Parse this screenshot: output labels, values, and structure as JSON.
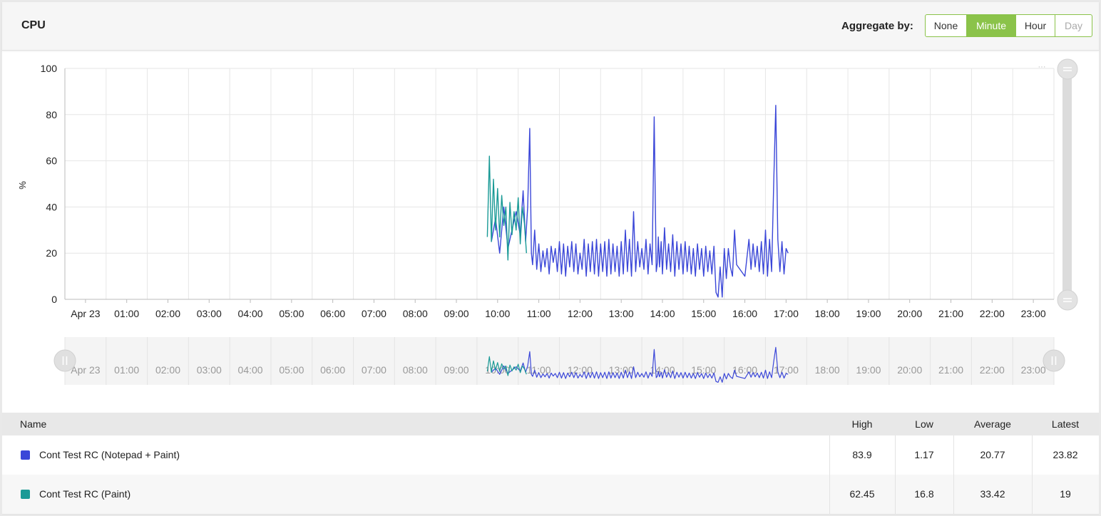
{
  "header": {
    "title": "CPU",
    "aggregate_label": "Aggregate by:",
    "options": [
      "None",
      "Minute",
      "Hour",
      "Day"
    ],
    "selected": "Minute",
    "disabled": [
      "Day"
    ]
  },
  "colors": {
    "accent": "#8bc34a",
    "series_blue": "#3b47d8",
    "series_teal": "#1a9a96"
  },
  "chart_data": {
    "type": "line",
    "ylabel": "%",
    "ylim": [
      0,
      100
    ],
    "yticks": [
      0,
      20,
      40,
      60,
      80,
      100
    ],
    "xlim": [
      -0.5,
      23.5
    ],
    "xticks": [
      "Apr 23",
      "01:00",
      "02:00",
      "03:00",
      "04:00",
      "05:00",
      "06:00",
      "07:00",
      "08:00",
      "09:00",
      "10:00",
      "11:00",
      "12:00",
      "13:00",
      "14:00",
      "15:00",
      "16:00",
      "17:00",
      "18:00",
      "19:00",
      "20:00",
      "21:00",
      "22:00",
      "23:00"
    ],
    "grid": true,
    "series": [
      {
        "name": "Cont Test RC (Notepad + Paint)",
        "color": "#3b47d8",
        "x": [
          9.85,
          9.95,
          10.05,
          10.15,
          10.25,
          10.35,
          10.45,
          10.55,
          10.62,
          10.68,
          10.73,
          10.78,
          10.82,
          10.85,
          10.9,
          10.95,
          11.0,
          11.05,
          11.1,
          11.15,
          11.2,
          11.25,
          11.3,
          11.35,
          11.4,
          11.45,
          11.5,
          11.55,
          11.6,
          11.65,
          11.7,
          11.75,
          11.8,
          11.85,
          11.9,
          11.95,
          12.0,
          12.05,
          12.1,
          12.15,
          12.2,
          12.25,
          12.3,
          12.35,
          12.4,
          12.45,
          12.5,
          12.55,
          12.6,
          12.65,
          12.7,
          12.75,
          12.8,
          12.85,
          12.9,
          12.95,
          13.0,
          13.05,
          13.1,
          13.15,
          13.2,
          13.25,
          13.3,
          13.35,
          13.4,
          13.45,
          13.5,
          13.55,
          13.6,
          13.65,
          13.7,
          13.75,
          13.8,
          13.85,
          13.88,
          13.9,
          13.93,
          13.97,
          14.0,
          14.05,
          14.1,
          14.15,
          14.2,
          14.25,
          14.3,
          14.35,
          14.4,
          14.45,
          14.5,
          14.55,
          14.6,
          14.65,
          14.7,
          14.75,
          14.8,
          14.85,
          14.9,
          14.95,
          15.0,
          15.05,
          15.1,
          15.15,
          15.2,
          15.25,
          15.3,
          15.35,
          15.4,
          15.45,
          15.5,
          15.55,
          15.6,
          15.65,
          15.7,
          15.75,
          15.8,
          16.0,
          16.1,
          16.15,
          16.2,
          16.25,
          16.3,
          16.35,
          16.4,
          16.45,
          16.5,
          16.55,
          16.6,
          16.65,
          16.7,
          16.75,
          16.8,
          16.85,
          16.9,
          16.95,
          17.0,
          17.05
        ],
        "y": [
          25,
          35,
          20,
          40,
          22,
          30,
          38,
          28,
          47,
          25,
          40,
          74,
          20,
          15,
          30,
          13,
          24,
          12,
          21,
          14,
          22,
          11,
          23,
          16,
          22,
          12,
          25,
          11,
          24,
          10,
          23,
          14,
          25,
          12,
          24,
          11,
          20,
          13,
          26,
          10,
          24,
          12,
          25,
          11,
          26,
          10,
          24,
          12,
          25,
          10,
          26,
          11,
          24,
          12,
          23,
          10,
          25,
          11,
          30,
          12,
          26,
          10,
          38,
          12,
          25,
          14,
          22,
          13,
          26,
          11,
          24,
          15,
          79,
          12,
          16,
          27,
          14,
          25,
          11,
          31,
          13,
          24,
          12,
          28,
          10,
          25,
          13,
          24,
          11,
          25,
          12,
          23,
          11,
          22,
          10,
          24,
          13,
          22,
          10,
          23,
          12,
          21,
          11,
          23,
          3,
          1,
          14,
          1,
          22,
          9,
          22,
          14,
          10,
          30,
          15,
          10,
          26,
          13,
          24,
          14,
          23,
          12,
          25,
          11,
          30,
          10,
          26,
          12,
          50,
          84,
          26,
          12,
          25,
          11,
          22,
          20
        ],
        "latest": "23.82",
        "high": "83.9",
        "low": "1.17",
        "average": "20.77"
      },
      {
        "name": "Cont Test RC (Paint)",
        "color": "#1a9a96",
        "x": [
          9.75,
          9.8,
          9.85,
          9.9,
          9.95,
          10.0,
          10.05,
          10.1,
          10.15,
          10.2,
          10.25,
          10.3,
          10.35,
          10.4,
          10.45,
          10.5,
          10.55,
          10.6,
          10.65,
          10.7
        ],
        "y": [
          27,
          62,
          25,
          52,
          30,
          48,
          27,
          45,
          32,
          40,
          17,
          42,
          28,
          38,
          30,
          44,
          24,
          40,
          33,
          20
        ],
        "high": "62.45",
        "low": "16.8",
        "average": "33.42",
        "latest": "19"
      }
    ]
  },
  "table": {
    "columns": [
      "Name",
      "High",
      "Low",
      "Average",
      "Latest"
    ],
    "rows": [
      {
        "name": "Cont Test RC (Notepad + Paint)",
        "color": "#3b47d8",
        "high": "83.9",
        "low": "1.17",
        "average": "20.77",
        "latest": "23.82"
      },
      {
        "name": "Cont Test RC (Paint)",
        "color": "#1a9a96",
        "high": "62.45",
        "low": "16.8",
        "average": "33.42",
        "latest": "19"
      }
    ]
  }
}
